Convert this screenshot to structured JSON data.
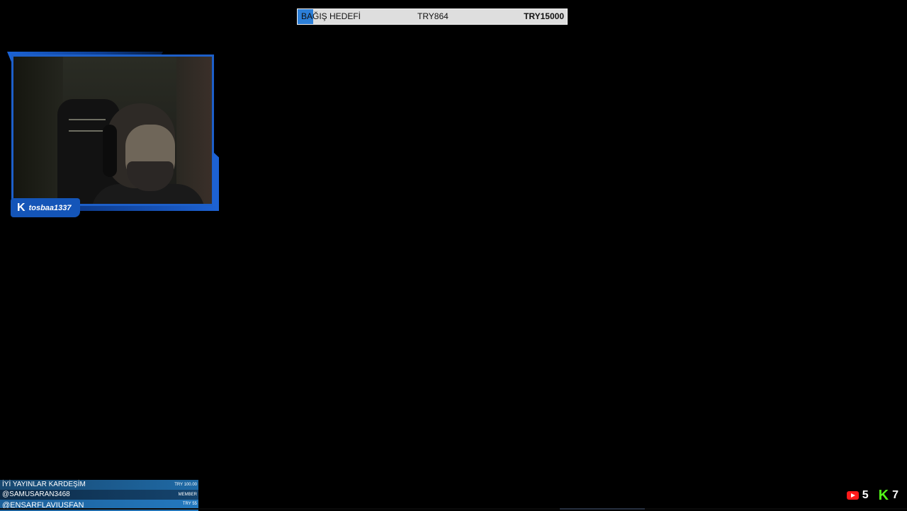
{
  "donation_goal": {
    "title": "BAĞIŞ HEDEFİ",
    "current": "TRY864",
    "target": "TRY15000",
    "progress_fraction": 0.0576,
    "fill_color": "#2c7fd8"
  },
  "webcam": {
    "platform_icon": "kick-logo-icon",
    "username": "tosbaa1337",
    "frame_color": "#1d5fc9"
  },
  "events": [
    {
      "text": "İYİ YAYINLAR KARDEŞİM",
      "meta": "TRY 100.00"
    },
    {
      "text": "@SAMUSARAN3468",
      "meta": "MEMBER"
    },
    {
      "text": "@ENSARFLAVIUSFAN",
      "meta": "TRY 55"
    }
  ],
  "viewers": {
    "youtube": {
      "icon": "youtube-icon",
      "count": "5",
      "color": "#ff1a1a"
    },
    "kick": {
      "icon": "kick-icon",
      "count": "7",
      "color": "#53fc18"
    }
  }
}
